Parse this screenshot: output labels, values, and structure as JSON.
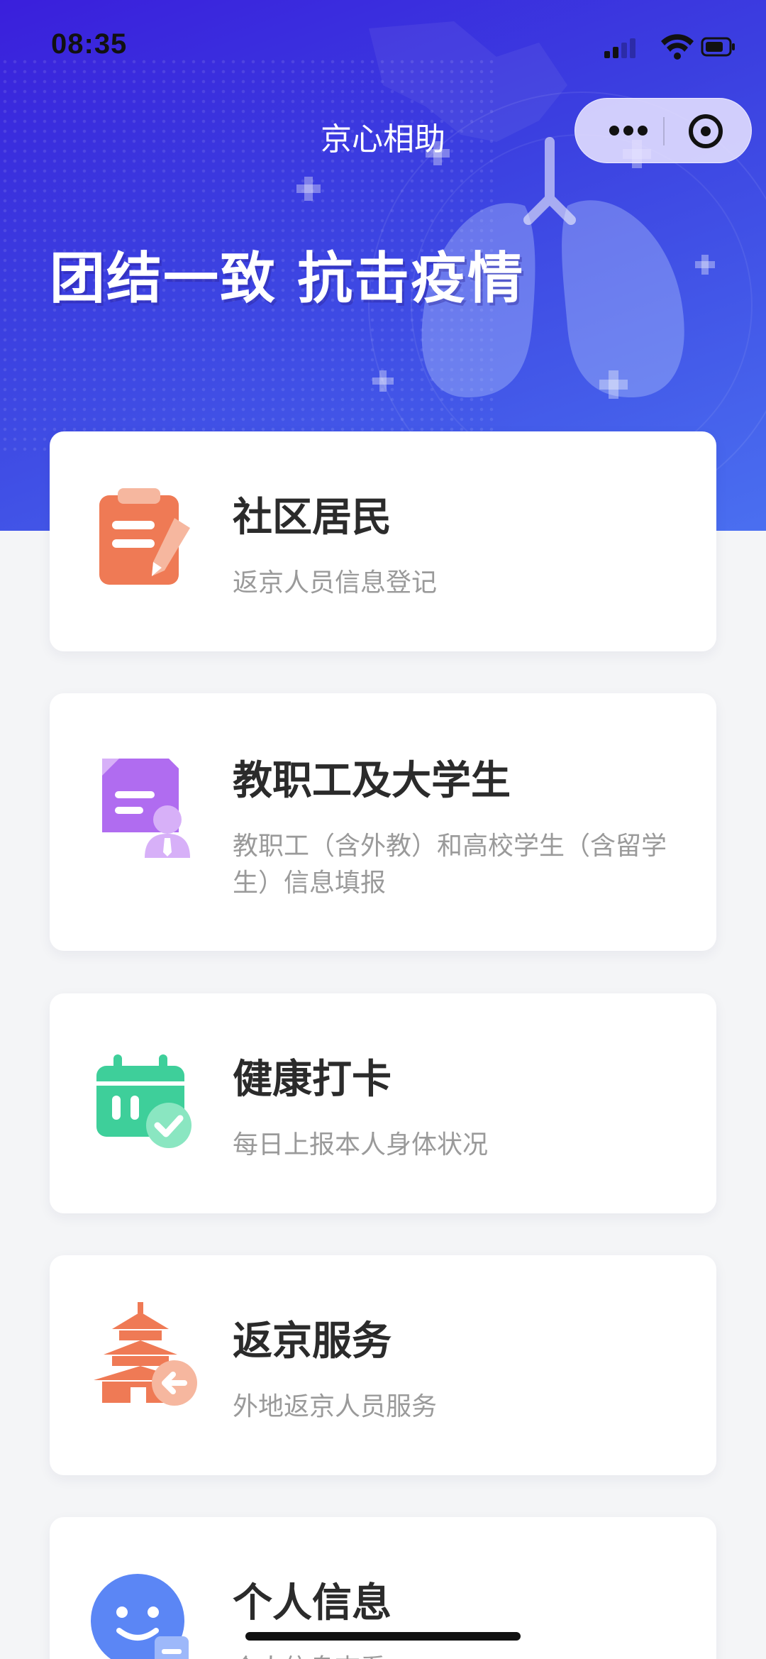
{
  "status_bar": {
    "time": "08:35"
  },
  "nav": {
    "title": "京心相助"
  },
  "hero": {
    "slogan": "团结一致 抗击疫情"
  },
  "colors": {
    "hero_bg": "#3a2fe0",
    "page_bg": "#f4f5f7",
    "card_bg": "#ffffff",
    "title_text": "#2b2b2b",
    "sub_text": "#9a9a9a"
  },
  "cards": [
    {
      "title": "社区居民",
      "subtitle": "返京人员信息登记",
      "icon": "clipboard-pen-icon",
      "color": "#ef7a55"
    },
    {
      "title": "教职工及大学生",
      "subtitle": "教职工（含外教）和高校学生（含留学生）信息填报",
      "icon": "document-person-icon",
      "color": "#b06cf0"
    },
    {
      "title": "健康打卡",
      "subtitle": "每日上报本人身体状况",
      "icon": "calendar-check-icon",
      "color": "#3ecf9a"
    },
    {
      "title": "返京服务",
      "subtitle": "外地返京人员服务",
      "icon": "temple-arrow-icon",
      "color": "#ef7a55"
    },
    {
      "title": "个人信息",
      "subtitle": "个人信息查看",
      "icon": "profile-card-icon",
      "color": "#5b86f5"
    }
  ]
}
